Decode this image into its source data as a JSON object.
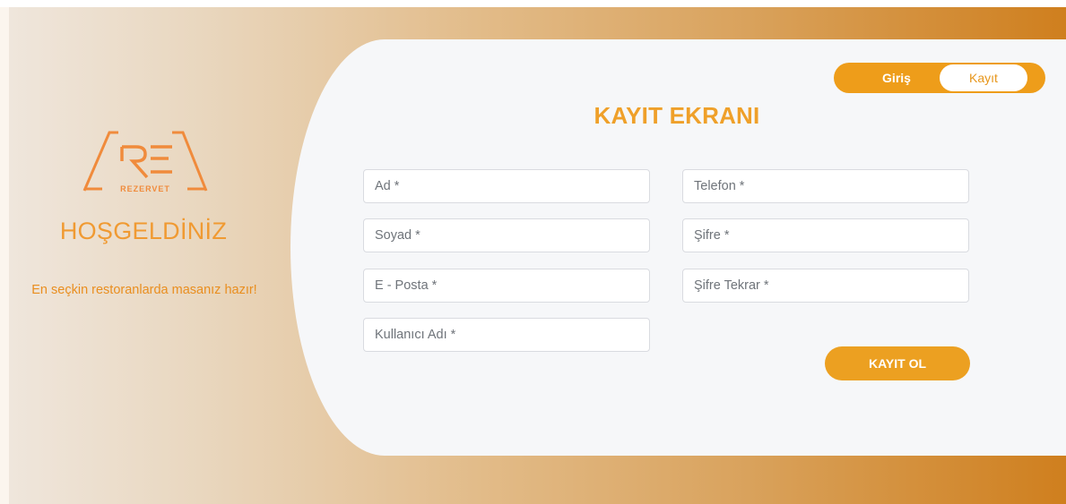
{
  "brand": {
    "logo_text": "REZERVET",
    "welcome": "HOŞGELDİNİZ",
    "tagline": "En seçkin restoranlarda masanız hazır!"
  },
  "toggle": {
    "login_label": "Giriş",
    "register_label": "Kayıt"
  },
  "form": {
    "title": "KAYIT EKRANI",
    "fields": {
      "first_name": "Ad *",
      "last_name": "Soyad *",
      "email": "E - Posta *",
      "username": "Kullanıcı Adı *",
      "phone": "Telefon *",
      "password": "Şifre *",
      "password_repeat": "Şifre Tekrar *"
    },
    "submit_label": "KAYIT OL"
  },
  "colors": {
    "accent": "#eca021",
    "brand_orange": "#f09a32",
    "card_bg": "#f6f7f9"
  }
}
